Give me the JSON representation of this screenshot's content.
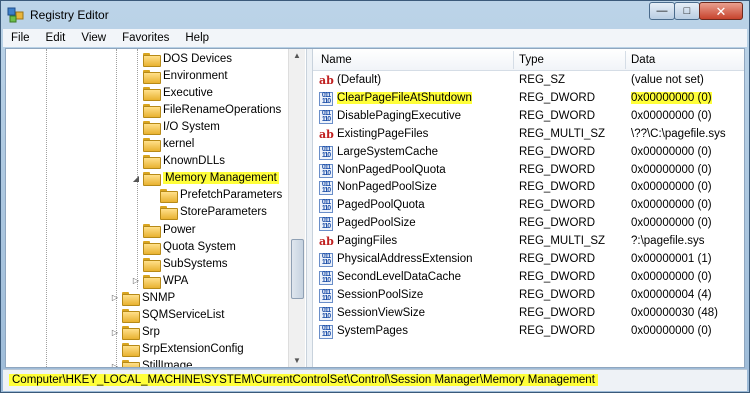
{
  "window": {
    "title": "Registry Editor"
  },
  "menu": [
    "File",
    "Edit",
    "View",
    "Favorites",
    "Help"
  ],
  "tree": {
    "items": [
      {
        "label": "DOS Devices",
        "level": 3,
        "expander": ""
      },
      {
        "label": "Environment",
        "level": 3,
        "expander": ""
      },
      {
        "label": "Executive",
        "level": 3,
        "expander": ""
      },
      {
        "label": "FileRenameOperations",
        "level": 3,
        "expander": ""
      },
      {
        "label": "I/O System",
        "level": 3,
        "expander": ""
      },
      {
        "label": "kernel",
        "level": 3,
        "expander": ""
      },
      {
        "label": "KnownDLLs",
        "level": 3,
        "expander": ""
      },
      {
        "label": "Memory Management",
        "level": 3,
        "expander": "expanded",
        "highlight": true
      },
      {
        "label": "PrefetchParameters",
        "level": 4,
        "expander": ""
      },
      {
        "label": "StoreParameters",
        "level": 4,
        "expander": ""
      },
      {
        "label": "Power",
        "level": 3,
        "expander": ""
      },
      {
        "label": "Quota System",
        "level": 3,
        "expander": ""
      },
      {
        "label": "SubSystems",
        "level": 3,
        "expander": ""
      },
      {
        "label": "WPA",
        "level": 3,
        "expander": "collapsed"
      },
      {
        "label": "SNMP",
        "level": 2,
        "expander": "collapsed"
      },
      {
        "label": "SQMServiceList",
        "level": 2,
        "expander": ""
      },
      {
        "label": "Srp",
        "level": 2,
        "expander": "collapsed"
      },
      {
        "label": "SrpExtensionConfig",
        "level": 2,
        "expander": ""
      },
      {
        "label": "StillImage",
        "level": 2,
        "expander": "collapsed"
      }
    ]
  },
  "list": {
    "columns": [
      "Name",
      "Type",
      "Data"
    ],
    "rows": [
      {
        "icon": "string-value-icon",
        "name": "(Default)",
        "type": "REG_SZ",
        "data": "(value not set)",
        "highlight": false
      },
      {
        "icon": "binary-value-icon",
        "name": "ClearPageFileAtShutdown",
        "type": "REG_DWORD",
        "data": "0x00000000 (0)",
        "highlight": true
      },
      {
        "icon": "binary-value-icon",
        "name": "DisablePagingExecutive",
        "type": "REG_DWORD",
        "data": "0x00000000 (0)",
        "highlight": false
      },
      {
        "icon": "string-value-icon",
        "name": "ExistingPageFiles",
        "type": "REG_MULTI_SZ",
        "data": "\\??\\C:\\pagefile.sys",
        "highlight": false
      },
      {
        "icon": "binary-value-icon",
        "name": "LargeSystemCache",
        "type": "REG_DWORD",
        "data": "0x00000000 (0)",
        "highlight": false
      },
      {
        "icon": "binary-value-icon",
        "name": "NonPagedPoolQuota",
        "type": "REG_DWORD",
        "data": "0x00000000 (0)",
        "highlight": false
      },
      {
        "icon": "binary-value-icon",
        "name": "NonPagedPoolSize",
        "type": "REG_DWORD",
        "data": "0x00000000 (0)",
        "highlight": false
      },
      {
        "icon": "binary-value-icon",
        "name": "PagedPoolQuota",
        "type": "REG_DWORD",
        "data": "0x00000000 (0)",
        "highlight": false
      },
      {
        "icon": "binary-value-icon",
        "name": "PagedPoolSize",
        "type": "REG_DWORD",
        "data": "0x00000000 (0)",
        "highlight": false
      },
      {
        "icon": "string-value-icon",
        "name": "PagingFiles",
        "type": "REG_MULTI_SZ",
        "data": "?:\\pagefile.sys",
        "highlight": false
      },
      {
        "icon": "binary-value-icon",
        "name": "PhysicalAddressExtension",
        "type": "REG_DWORD",
        "data": "0x00000001 (1)",
        "highlight": false
      },
      {
        "icon": "binary-value-icon",
        "name": "SecondLevelDataCache",
        "type": "REG_DWORD",
        "data": "0x00000000 (0)",
        "highlight": false
      },
      {
        "icon": "binary-value-icon",
        "name": "SessionPoolSize",
        "type": "REG_DWORD",
        "data": "0x00000004 (4)",
        "highlight": false
      },
      {
        "icon": "binary-value-icon",
        "name": "SessionViewSize",
        "type": "REG_DWORD",
        "data": "0x00000030 (48)",
        "highlight": false
      },
      {
        "icon": "binary-value-icon",
        "name": "SystemPages",
        "type": "REG_DWORD",
        "data": "0x00000000 (0)",
        "highlight": false
      }
    ]
  },
  "status": {
    "path": "Computer\\HKEY_LOCAL_MACHINE\\SYSTEM\\CurrentControlSet\\Control\\Session Manager\\Memory Management"
  }
}
